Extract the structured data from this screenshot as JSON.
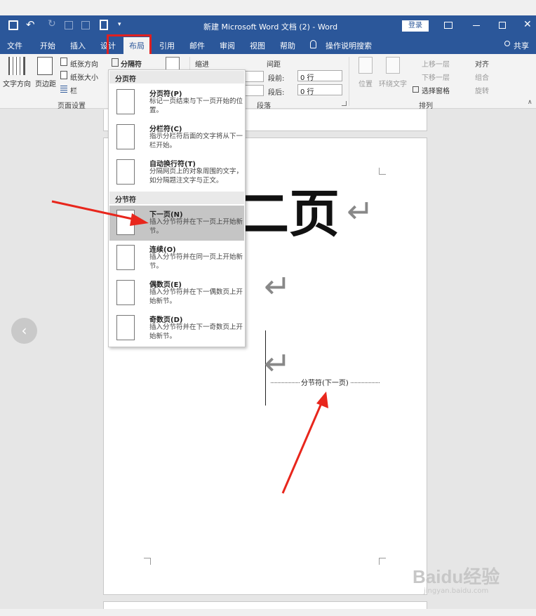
{
  "window": {
    "title": "新建 Microsoft Word 文档 (2)  -  Word",
    "login_label": "登录"
  },
  "tabs": [
    {
      "label": "文件"
    },
    {
      "label": "开始"
    },
    {
      "label": "插入"
    },
    {
      "label": "设计"
    },
    {
      "label": "布局"
    },
    {
      "label": "引用"
    },
    {
      "label": "邮件"
    },
    {
      "label": "审阅"
    },
    {
      "label": "视图"
    },
    {
      "label": "帮助"
    }
  ],
  "tell_me": "操作说明搜索",
  "share_label": "共享",
  "ribbon": {
    "text_direction": "文字方向",
    "margins": "页边距",
    "orientation": "纸张方向",
    "size": "纸张大小",
    "columns": "栏",
    "breaks": "分隔符",
    "page_setup_label": "页面设置",
    "indent_label": "缩进",
    "spacing_label": "间距",
    "before_label": "段前:",
    "before_value": "0 行",
    "after_label": "段后:",
    "after_value": "0 行",
    "paragraph_label": "段落",
    "position": "位置",
    "wrap_text": "环绕文字",
    "bring_forward": "上移一层",
    "send_backward": "下移一层",
    "selection_pane": "选择窗格",
    "align": "对齐",
    "group": "组合",
    "rotate": "旋转",
    "arrange_label": "排列"
  },
  "menu": {
    "section_page": "分页符",
    "section_section": "分节符",
    "items": [
      {
        "title": "分页符(P)",
        "desc": "标记一页结束与下一页开始的位置。"
      },
      {
        "title": "分栏符(C)",
        "desc": "指示分栏符后面的文字将从下一栏开始。"
      },
      {
        "title": "自动换行符(T)",
        "desc": "分隔网页上的对象周围的文字，如分隔题注文字与正文。"
      },
      {
        "title": "下一页(N)",
        "desc": "插入分节符并在下一页上开始新节。"
      },
      {
        "title": "连续(O)",
        "desc": "插入分节符并在同一页上开始新节。"
      },
      {
        "title": "偶数页(E)",
        "desc": "插入分节符并在下一偶数页上开始新节。"
      },
      {
        "title": "奇数页(D)",
        "desc": "插入分节符并在下一奇数页上开始新节。"
      }
    ]
  },
  "document": {
    "heading": "二页",
    "section_break": "分节符(下一页)"
  },
  "watermark": {
    "logo": "Baidu经验",
    "url": "jingyan.baidu.com"
  }
}
